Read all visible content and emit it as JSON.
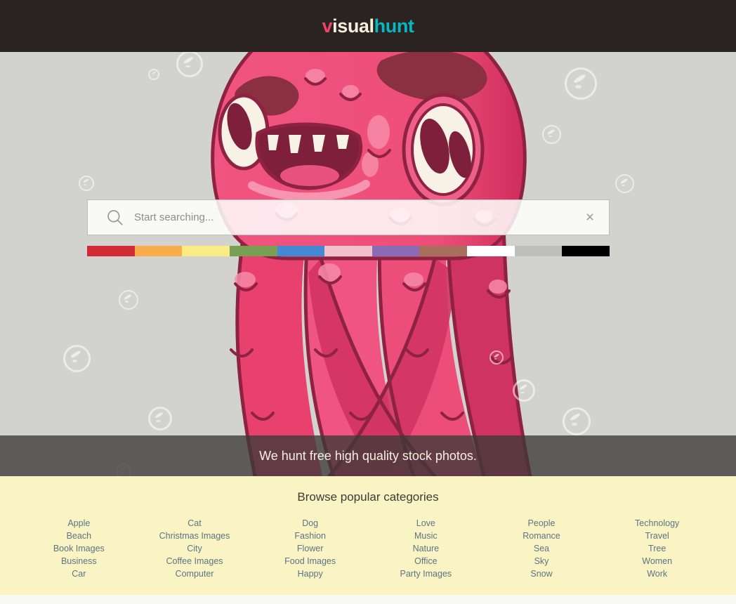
{
  "header": {
    "logo": {
      "part1": "v",
      "part2": "isual",
      "part3": "hunt",
      "color1": "#f0436c",
      "color2": "#f7f0dc",
      "color3": "#07b8bf"
    },
    "background": "#2b2321"
  },
  "hero": {
    "background": "#d2d3ce",
    "illustration_name": "pink-monster-octopus"
  },
  "search": {
    "placeholder": "Start searching...",
    "value": "",
    "search_icon": "search-icon",
    "clear_icon": "close-icon",
    "clear_label": "×"
  },
  "color_filters": [
    {
      "name": "red",
      "hex": "#d32b36"
    },
    {
      "name": "orange",
      "hex": "#f9ac4c"
    },
    {
      "name": "yellow",
      "hex": "#fbeb84"
    },
    {
      "name": "green",
      "hex": "#77a055"
    },
    {
      "name": "blue",
      "hex": "#4489d6"
    },
    {
      "name": "pink",
      "hex": "#f0c0cd"
    },
    {
      "name": "purple",
      "hex": "#8a6bb8"
    },
    {
      "name": "brown",
      "hex": "#a8705c"
    },
    {
      "name": "white",
      "hex": "#ffffff"
    },
    {
      "name": "gray",
      "hex": "#bebebe"
    },
    {
      "name": "black",
      "hex": "#000000"
    }
  ],
  "tagline": {
    "text": "We hunt free high quality stock photos."
  },
  "categories": {
    "title": "Browse popular categories",
    "columns": [
      {
        "items": [
          "Apple",
          "Beach",
          "Book Images",
          "Business",
          "Car"
        ]
      },
      {
        "items": [
          "Cat",
          "Christmas Images",
          "City",
          "Coffee Images",
          "Computer"
        ]
      },
      {
        "items": [
          "Dog",
          "Fashion",
          "Flower",
          "Food Images",
          "Happy"
        ]
      },
      {
        "items": [
          "Love",
          "Music",
          "Nature",
          "Office",
          "Party Images"
        ]
      },
      {
        "items": [
          "People",
          "Romance",
          "Sea",
          "Sky",
          "Snow"
        ]
      },
      {
        "items": [
          "Technology",
          "Travel",
          "Tree",
          "Women",
          "Work"
        ]
      }
    ],
    "background": "#faf3c3",
    "link_color": "#5a7585"
  }
}
